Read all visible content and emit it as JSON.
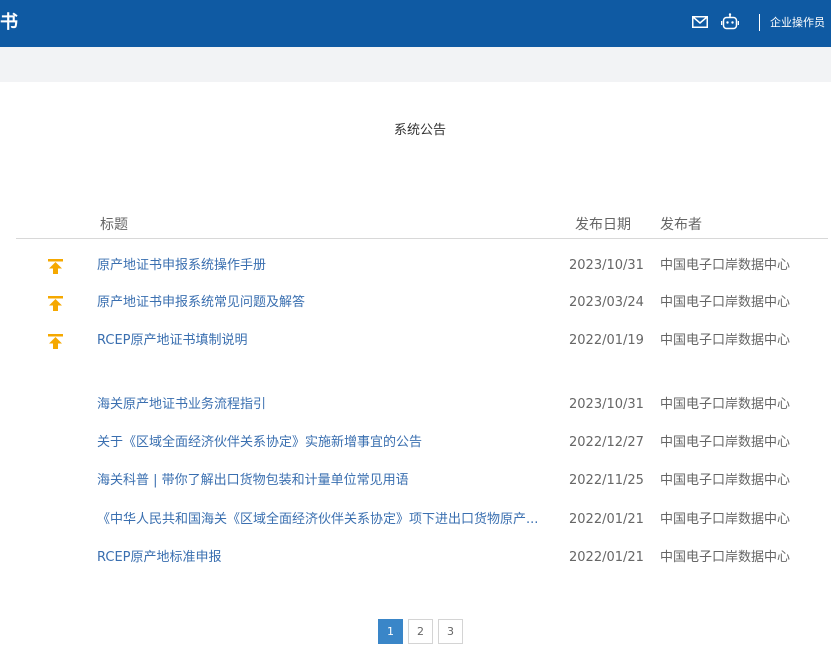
{
  "header": {
    "title": "书",
    "user_label": "企业操作员",
    "icons": [
      "mail-icon",
      "robot-icon"
    ],
    "color": "#0f5aa3"
  },
  "page": {
    "title": "系统公告"
  },
  "table": {
    "columns": {
      "title": "标题",
      "date": "发布日期",
      "publisher": "发布者"
    },
    "pinned": [
      {
        "title": "原产地证书申报系统操作手册",
        "date": "2023/10/31",
        "publisher": "中国电子口岸数据中心"
      },
      {
        "title": "原产地证书申报系统常见问题及解答",
        "date": "2023/03/24",
        "publisher": "中国电子口岸数据中心"
      },
      {
        "title": "RCEP原产地证书填制说明",
        "date": "2022/01/19",
        "publisher": "中国电子口岸数据中心"
      }
    ],
    "rows": [
      {
        "title": "海关原产地证书业务流程指引",
        "date": "2023/10/31",
        "publisher": "中国电子口岸数据中心"
      },
      {
        "title": "关于《区域全面经济伙伴关系协定》实施新增事宜的公告",
        "date": "2022/12/27",
        "publisher": "中国电子口岸数据中心"
      },
      {
        "title": "海关科普 | 带你了解出口货物包装和计量单位常见用语",
        "date": "2022/11/25",
        "publisher": "中国电子口岸数据中心"
      },
      {
        "title": "《中华人民共和国海关《区域全面经济伙伴关系协定》项下进出口货物原产...",
        "date": "2022/01/21",
        "publisher": "中国电子口岸数据中心"
      },
      {
        "title": "RCEP原产地标准申报",
        "date": "2022/01/21",
        "publisher": "中国电子口岸数据中心"
      }
    ]
  },
  "pagination": {
    "pages": [
      "1",
      "2",
      "3"
    ],
    "current": "1"
  }
}
